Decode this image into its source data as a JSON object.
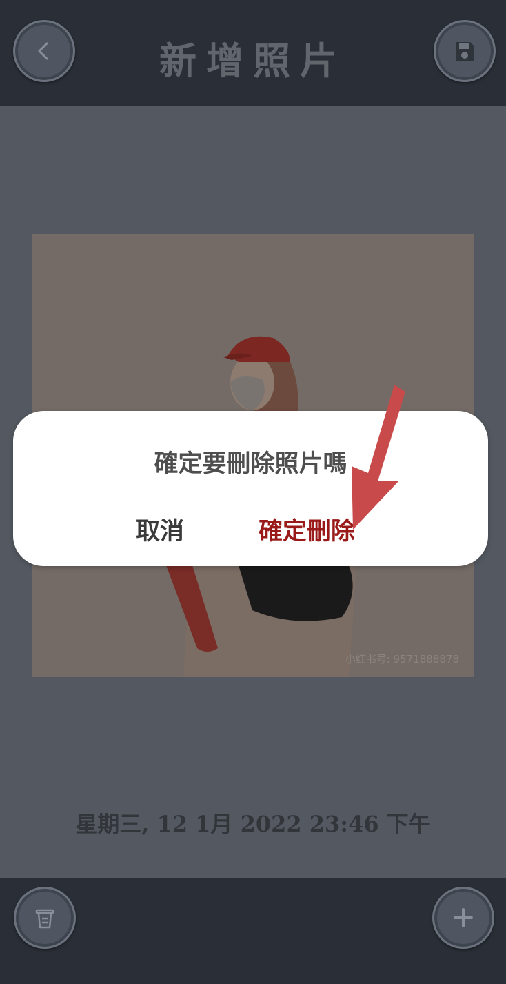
{
  "header": {
    "title": "新增照片",
    "back_icon": "chevron-left-icon",
    "save_icon": "floppy-disk-icon"
  },
  "photo": {
    "watermark": "小红书号: 9571888878",
    "logo_text": "小红书"
  },
  "date_text": "星期三, 12 1月 2022 23:46 下午",
  "dialog": {
    "message": "確定要刪除照片嗎",
    "cancel_label": "取消",
    "confirm_label": "確定刪除"
  },
  "footer": {
    "delete_icon": "trash-icon",
    "add_icon": "plus-icon"
  },
  "colors": {
    "bar": "#2a2f37",
    "overlay_bg": "#545961",
    "confirm": "#9a1a1a",
    "arrow": "#c94a4a"
  }
}
